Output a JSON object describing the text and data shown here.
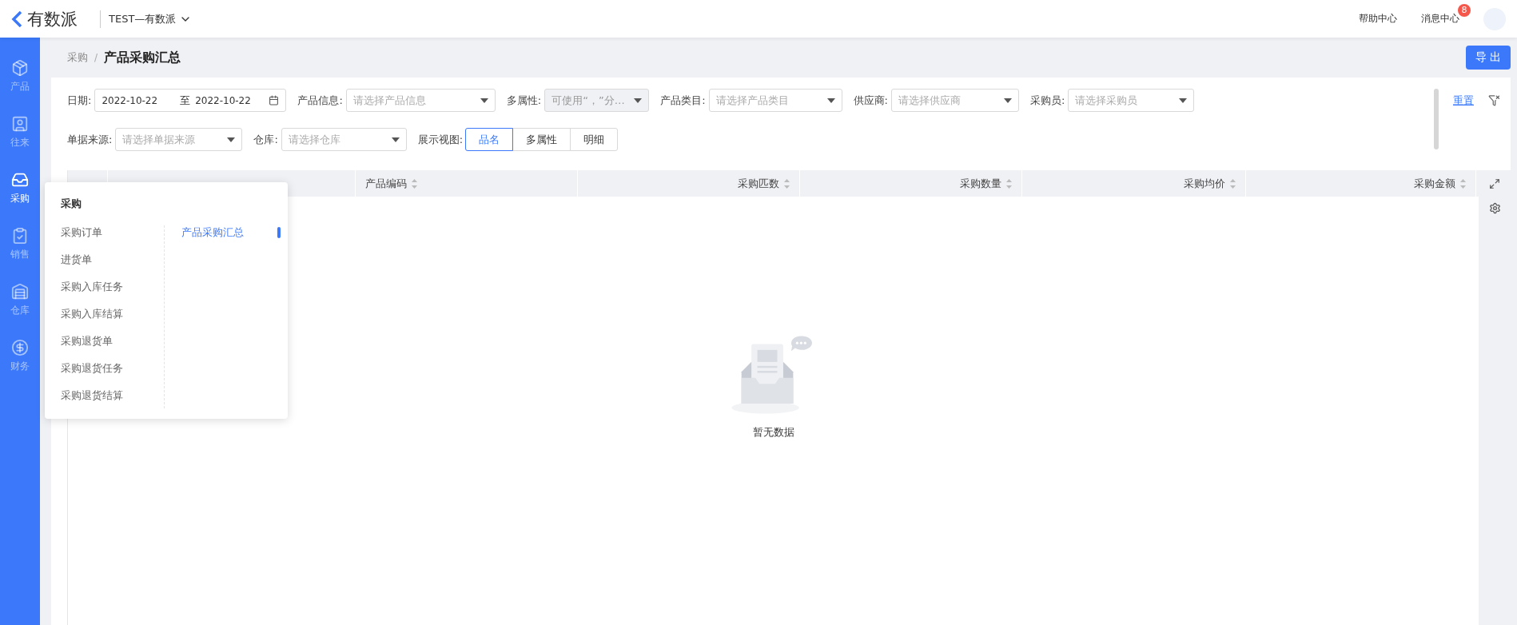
{
  "topbar": {
    "logo": "有数派",
    "org": "TEST—有数派",
    "links": [
      {
        "label": "帮助中心"
      },
      {
        "label": "消息中心",
        "badge": "8"
      }
    ]
  },
  "sidebar": {
    "items": [
      {
        "label": "产品",
        "selected": false
      },
      {
        "label": "往来",
        "selected": false
      },
      {
        "label": "采购",
        "selected": true
      },
      {
        "label": "销售",
        "selected": false
      },
      {
        "label": "仓库",
        "selected": false
      },
      {
        "label": "财务",
        "selected": false
      }
    ]
  },
  "breadcrumb": {
    "parent": "采购",
    "separator": "/",
    "current": "产品采购汇总"
  },
  "export_button": "导 出",
  "filter_rows": [
    [
      {
        "kind": "daterange",
        "label": "日期:",
        "start": "2022-10-22",
        "separator": "至",
        "end": "2022-10-22",
        "disabled": false
      },
      {
        "kind": "select",
        "label": "产品信息:",
        "placeholder": "请选择产品信息",
        "disabled": false
      },
      {
        "kind": "select",
        "label": "多属性:",
        "value": "可使用“，”分…",
        "disabled": true
      },
      {
        "kind": "select",
        "label": "产品类目:",
        "placeholder": "请选择产品类目",
        "disabled": false
      },
      {
        "kind": "select",
        "label": "供应商:",
        "placeholder": "请选择供应商",
        "disabled": false
      },
      {
        "kind": "select",
        "label": "采购员:",
        "placeholder": "请选择采购员",
        "disabled": false
      }
    ],
    [
      {
        "kind": "select",
        "label": "单据来源:",
        "placeholder": "请选择单据来源",
        "disabled": false
      },
      {
        "kind": "select",
        "label": "仓库:",
        "placeholder": "请选择仓库",
        "disabled": false
      },
      {
        "kind": "segmented",
        "label": "展示视图:",
        "options": [
          {
            "label": "品名",
            "selected": true
          },
          {
            "label": "多属性",
            "selected": false
          },
          {
            "label": "明细",
            "selected": false
          }
        ],
        "disabled": false
      }
    ]
  ],
  "reset_link": "重置",
  "table": {
    "columns": [
      {
        "kind": "hidden"
      },
      {
        "kind": "hidden"
      },
      {
        "kind": "text",
        "label": "产品编码"
      },
      {
        "kind": "number",
        "label": "采购匹数"
      },
      {
        "kind": "number",
        "label": "采购数量"
      },
      {
        "kind": "number",
        "label": "采购均价"
      },
      {
        "kind": "number",
        "label": "采购金额"
      }
    ],
    "empty_text": "暂无数据"
  },
  "popup_menu": {
    "title": "采购",
    "left_items": [
      {
        "label": "采购订单",
        "selected": false
      },
      {
        "label": "进货单",
        "selected": false
      },
      {
        "label": "采购入库任务",
        "selected": false
      },
      {
        "label": "采购入库结算",
        "selected": false
      },
      {
        "label": "采购退货单",
        "selected": false
      },
      {
        "label": "采购退货任务",
        "selected": false
      },
      {
        "label": "采购退货结算",
        "selected": false
      }
    ],
    "right_items": [
      {
        "label": "产品采购汇总",
        "selected": true
      }
    ]
  }
}
